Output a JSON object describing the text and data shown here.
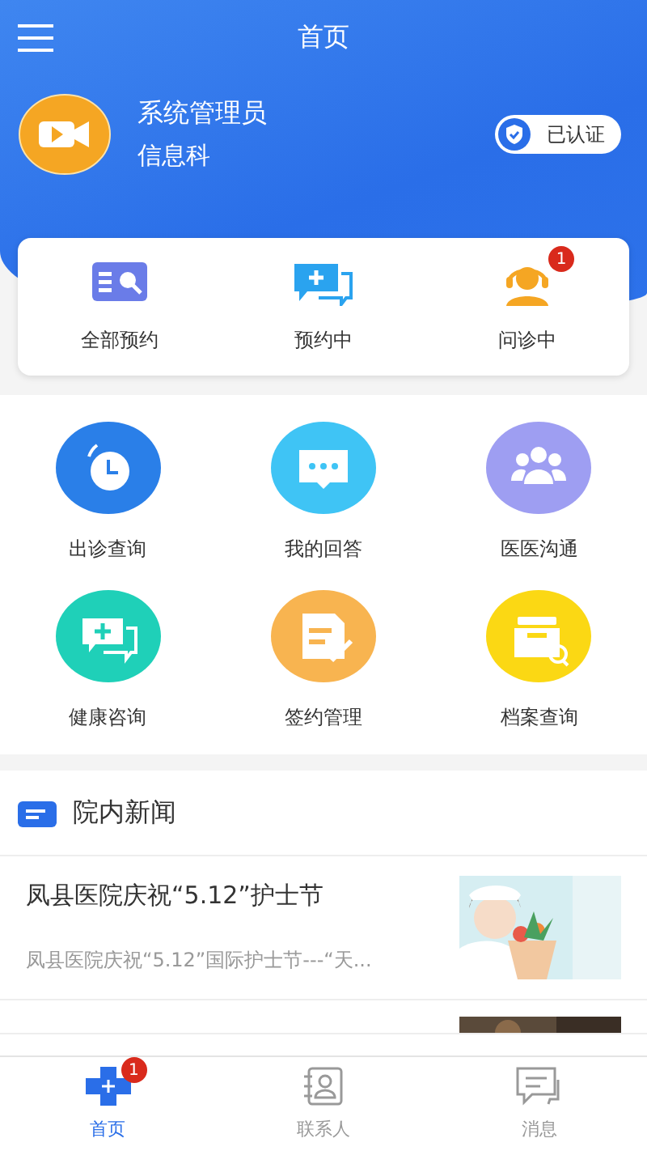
{
  "header": {
    "title": "首页"
  },
  "profile": {
    "name": "系统管理员",
    "department": "信息科",
    "verified_label": "已认证"
  },
  "status_items": [
    {
      "kind": "all",
      "label": "全部预约"
    },
    {
      "kind": "booking",
      "label": "预约中"
    },
    {
      "kind": "consult",
      "label": "问诊中",
      "badge": "1"
    }
  ],
  "features": [
    {
      "kind": "clock",
      "label": "出诊查询",
      "color": "#2a7fe8"
    },
    {
      "kind": "chat",
      "label": "我的回答",
      "color": "#3fc4f5"
    },
    {
      "kind": "group",
      "label": "医医沟通",
      "color": "#9e9ef2"
    },
    {
      "kind": "plus-chat",
      "label": "健康咨询",
      "color": "#1fd0b8"
    },
    {
      "kind": "doc",
      "label": "签约管理",
      "color": "#f8b450"
    },
    {
      "kind": "archive",
      "label": "档案查询",
      "color": "#fbd814"
    }
  ],
  "news": {
    "title": "院内新闻",
    "items": [
      {
        "title": "凤县医院庆祝“5.12”护士节",
        "summary": "凤县医院庆祝“5.12”国际护士节---“天..."
      }
    ]
  },
  "tabs": [
    {
      "kind": "home",
      "label": "首页",
      "selected": true,
      "badge": "1"
    },
    {
      "kind": "contacts",
      "label": "联系人",
      "selected": false
    },
    {
      "kind": "messages",
      "label": "消息",
      "selected": false
    }
  ]
}
